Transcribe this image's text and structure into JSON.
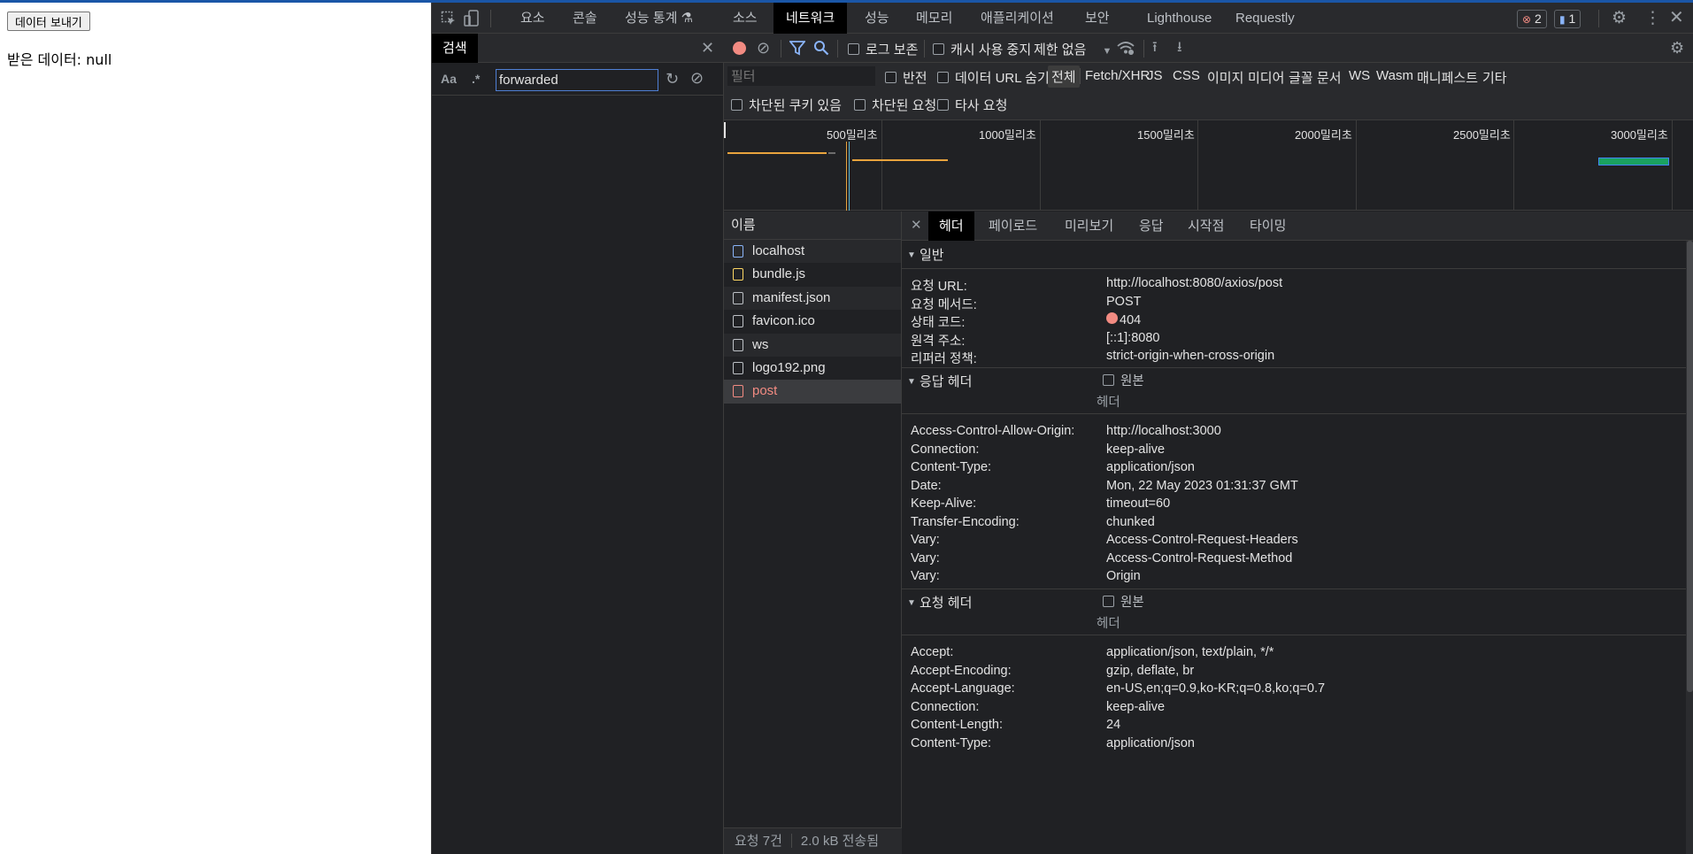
{
  "page": {
    "send_button": "데이터 보내기",
    "received_label": "받은 데이터: null"
  },
  "devtools": {
    "tabs": [
      "요소",
      "콘솔",
      "성능 통계 ⚗",
      "소스",
      "네트워크",
      "성능",
      "메모리",
      "애플리케이션",
      "보안",
      "Lighthouse",
      "Requestly"
    ],
    "active_tab": "네트워크",
    "error_count": "2",
    "message_count": "1"
  },
  "search": {
    "tab_label": "검색",
    "case_toggle": "Aa",
    "regex_toggle": ".*",
    "query": "forwarded"
  },
  "network": {
    "preserve_log": "로그 보존",
    "disable_cache": "캐시 사용 중지",
    "throttle": "제한 없음",
    "filter_placeholder": "필터",
    "invert": "반전",
    "hide_data_urls": "데이터 URL 숨기기",
    "type_filters": [
      "전체",
      "Fetch/XHR",
      "JS",
      "CSS",
      "이미지",
      "미디어",
      "글꼴",
      "문서",
      "WS",
      "Wasm",
      "매니페스트",
      "기타"
    ],
    "blocked_cookies": "차단된 쿠키 있음",
    "blocked_requests": "차단된 요청",
    "third_party": "타사 요청",
    "timeline_labels": [
      "500밀리초",
      "1000밀리초",
      "1500밀리초",
      "2000밀리초",
      "2500밀리초",
      "3000밀리초"
    ],
    "name_column": "이름",
    "requests": [
      {
        "name": "localhost",
        "type": "doc"
      },
      {
        "name": "bundle.js",
        "type": "js"
      },
      {
        "name": "manifest.json",
        "type": "file"
      },
      {
        "name": "favicon.ico",
        "type": "file"
      },
      {
        "name": "ws",
        "type": "file"
      },
      {
        "name": "logo192.png",
        "type": "file"
      },
      {
        "name": "post",
        "type": "error"
      }
    ],
    "footer_requests": "요청 7건",
    "footer_transferred": "2.0 kB 전송됨"
  },
  "detail": {
    "tabs": [
      "헤더",
      "페이로드",
      "미리보기",
      "응답",
      "시작점",
      "타이밍"
    ],
    "active_tab": "헤더",
    "general_title": "일반",
    "general": [
      {
        "k": "요청 URL:",
        "v": "http://localhost:8080/axios/post"
      },
      {
        "k": "요청 메서드:",
        "v": "POST"
      },
      {
        "k": "상태 코드:",
        "v": "404"
      },
      {
        "k": "원격 주소:",
        "v": "[::1]:8080"
      },
      {
        "k": "리퍼러 정책:",
        "v": "strict-origin-when-cross-origin"
      }
    ],
    "response_title": "응답 헤더",
    "raw_label": "원본",
    "header_sub": "헤더",
    "response_headers": [
      {
        "k": "Access-Control-Allow-Origin:",
        "v": "http://localhost:3000"
      },
      {
        "k": "Connection:",
        "v": "keep-alive"
      },
      {
        "k": "Content-Type:",
        "v": "application/json"
      },
      {
        "k": "Date:",
        "v": "Mon, 22 May 2023 01:31:37 GMT"
      },
      {
        "k": "Keep-Alive:",
        "v": "timeout=60"
      },
      {
        "k": "Transfer-Encoding:",
        "v": "chunked"
      },
      {
        "k": "Vary:",
        "v": "Access-Control-Request-Headers"
      },
      {
        "k": "Vary:",
        "v": "Access-Control-Request-Method"
      },
      {
        "k": "Vary:",
        "v": "Origin"
      }
    ],
    "request_title": "요청 헤더",
    "request_headers": [
      {
        "k": "Accept:",
        "v": "application/json, text/plain, */*"
      },
      {
        "k": "Accept-Encoding:",
        "v": "gzip, deflate, br"
      },
      {
        "k": "Accept-Language:",
        "v": "en-US,en;q=0.9,ko-KR;q=0.8,ko;q=0.7"
      },
      {
        "k": "Connection:",
        "v": "keep-alive"
      },
      {
        "k": "Content-Length:",
        "v": "24"
      },
      {
        "k": "Content-Type:",
        "v": "application/json"
      }
    ]
  },
  "colors": {
    "error": "#f28b82",
    "record": "#f28b82",
    "accent": "#8ab4f8"
  }
}
